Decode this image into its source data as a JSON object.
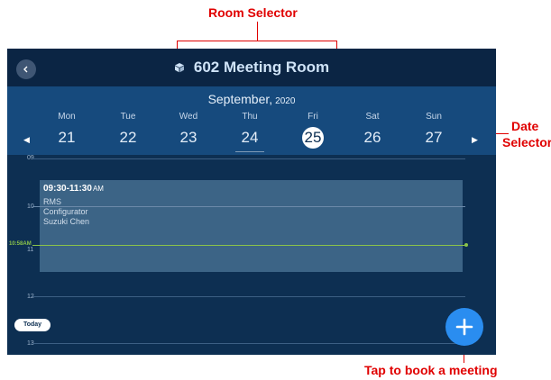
{
  "annotations": {
    "room_selector": "Room Selector",
    "date_selector_line1": "Date",
    "date_selector_line2": "Selector",
    "book_meeting": "Tap to book a meeting"
  },
  "header": {
    "room_name": "602 Meeting Room",
    "icon": "cube-icon"
  },
  "calendar": {
    "month": "September,",
    "year": "2020",
    "days": [
      {
        "name": "Mon",
        "date": "21"
      },
      {
        "name": "Tue",
        "date": "22"
      },
      {
        "name": "Wed",
        "date": "23"
      },
      {
        "name": "Thu",
        "date": "24"
      },
      {
        "name": "Fri",
        "date": "25"
      },
      {
        "name": "Sat",
        "date": "26"
      },
      {
        "name": "Sun",
        "date": "27"
      }
    ],
    "selected_date": "25",
    "today_date": "24"
  },
  "timeline": {
    "hours": [
      "09",
      "10",
      "11",
      "12",
      "13"
    ],
    "now_label": "10:58",
    "now_ampm": "AM",
    "meeting": {
      "time": "09:30-11:30",
      "ampm": "AM",
      "lines": [
        "RMS",
        "Configurator",
        "Suzuki Chen"
      ]
    },
    "today_button": "Today"
  },
  "colors": {
    "annotation": "#e00000",
    "background": "#0d2f52",
    "date_bar": "#164a7d",
    "meeting_block": "#3c6486",
    "now_line": "#8bc34a",
    "fab": "#2a8df0"
  }
}
